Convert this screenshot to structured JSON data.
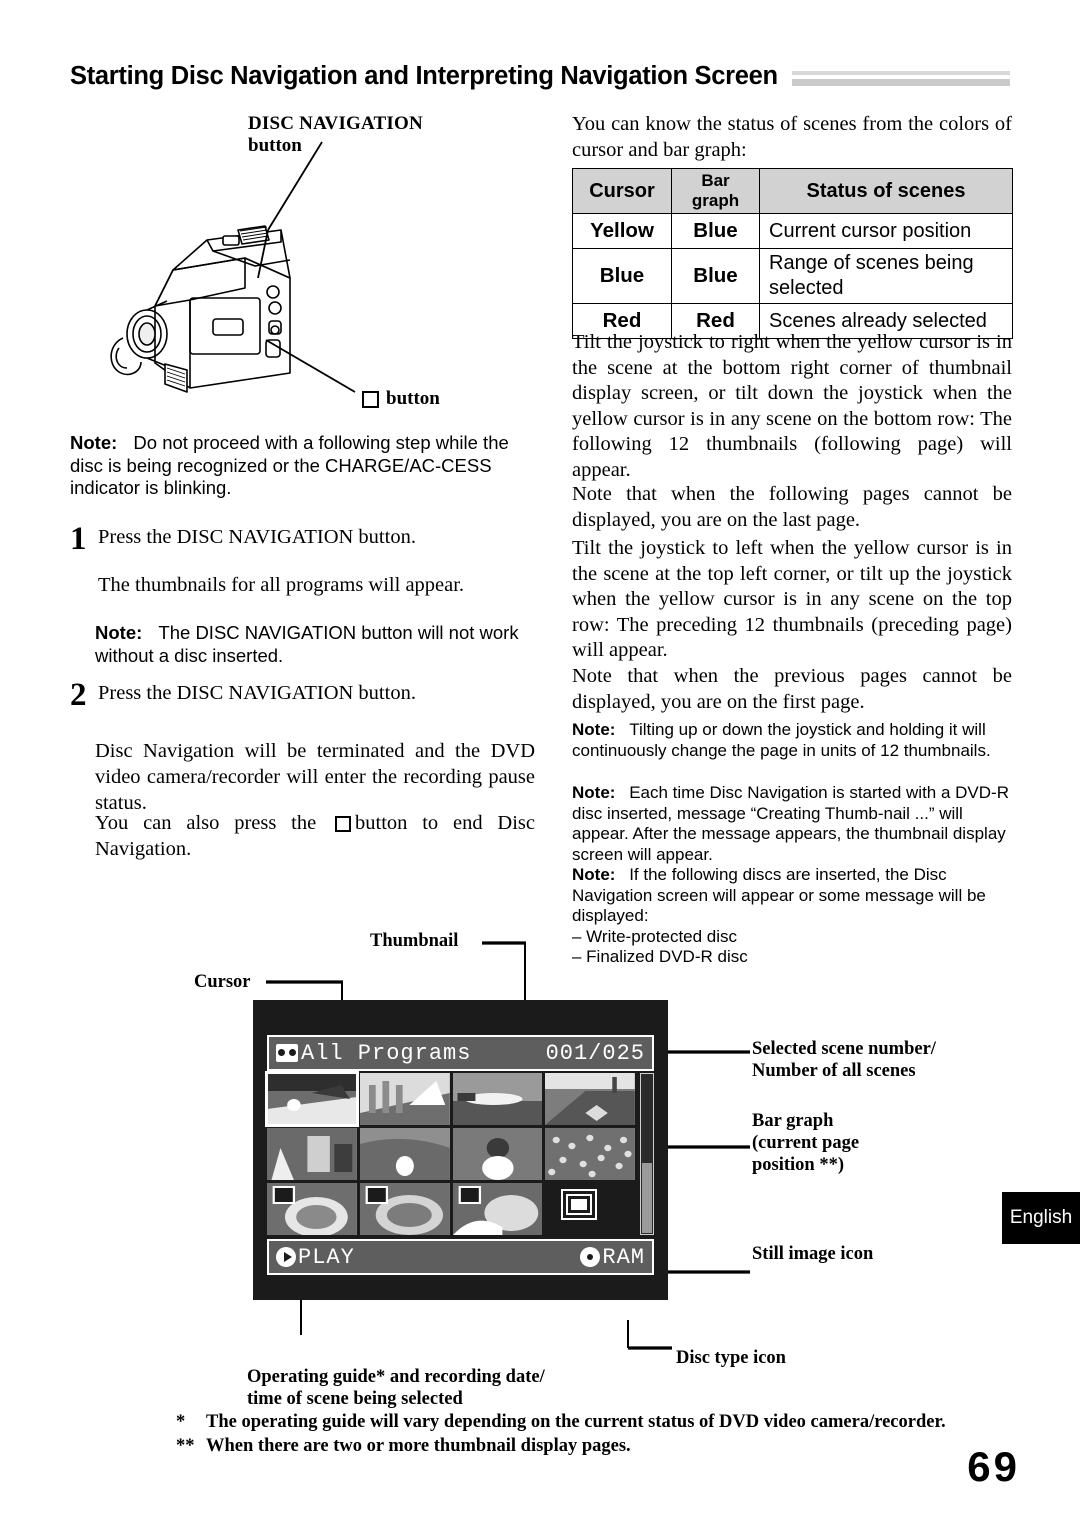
{
  "header": {
    "title": "Starting Disc Navigation and Interpreting Navigation Screen"
  },
  "illustration": {
    "disc_nav_label_line1": "DISC NAVIGATION",
    "disc_nav_label_line2": "button",
    "square_button_label": "button"
  },
  "left_column": {
    "note1": {
      "label": "Note:",
      "text": "Do not proceed with a following step while the disc is being recognized or the CHARGE/AC-CESS indicator is blinking."
    },
    "step1": {
      "number": "1",
      "instruction": "Press the DISC NAVIGATION button.",
      "result": "The thumbnails for all programs will appear."
    },
    "note2": {
      "label": "Note:",
      "text": "The DISC NAVIGATION button will not work without a disc inserted."
    },
    "step2": {
      "number": "2",
      "instruction": "Press the DISC NAVIGATION button.",
      "result_part1": "Disc Navigation will be terminated and the DVD video camera/recorder will enter the recording pause status.",
      "result_part2_pre": "You can also press the",
      "result_part2_post": "button to end Disc Navigation."
    }
  },
  "right_column": {
    "intro": "You can know the status of scenes from the colors of cursor and bar graph:",
    "table": {
      "headers": [
        "Cursor",
        "Bar graph",
        "Status of scenes"
      ],
      "rows": [
        {
          "cursor": "Yellow",
          "bar_graph": "Blue",
          "status": "Current cursor position"
        },
        {
          "cursor": "Blue",
          "bar_graph": "Blue",
          "status": "Range of scenes being selected"
        },
        {
          "cursor": "Red",
          "bar_graph": "Red",
          "status": "Scenes already selected"
        }
      ]
    },
    "para1": "Tilt the joystick to right when the yellow cursor is in the scene at the bottom right corner of thumbnail display screen, or tilt down the joystick when the yellow cursor is in any scene on the bottom row: The following 12 thumbnails (following page) will appear.",
    "para2": "Note that when the following pages cannot be displayed, you are on the last page.",
    "para3": "Tilt the joystick to left when the yellow cursor is in the scene at the top left corner, or tilt up the joystick when the yellow cursor is in any scene on the top row: The preceding 12 thumbnails (preceding page) will appear.",
    "para4": "Note that when the previous pages cannot be displayed, you are on the first page.",
    "note3": {
      "label": "Note:",
      "text": "Tilting up or down the joystick and holding it will continuously change the page in units of 12 thumbnails."
    },
    "note4": {
      "label": "Note:",
      "text": "Each time Disc Navigation is started with a DVD-R disc inserted, message “Creating Thumb-nail ...” will appear. After the message appears, the thumbnail display screen will appear."
    },
    "note5": {
      "label": "Note:",
      "text": "If the following discs are inserted, the Disc Navigation screen will appear or some message will be displayed:",
      "bullets": [
        "– Write-protected disc",
        "– Finalized DVD-R disc"
      ]
    }
  },
  "screen_diagram": {
    "callouts": {
      "thumbnail": "Thumbnail",
      "cursor": "Cursor",
      "selected_scene_number_line1": "Selected scene number/",
      "selected_scene_number_line2": "Number of all scenes",
      "bar_graph_line1": "Bar graph",
      "bar_graph_line2": "(current page",
      "bar_graph_line3": "position **)",
      "still_image_icon": "Still image icon",
      "disc_type_icon": "Disc type icon",
      "operating_guide_line1": "Operating guide* and recording date/",
      "operating_guide_line2": "time of scene being selected"
    },
    "lcd": {
      "program_title": "All Programs",
      "scene_counter": "001/025",
      "operating_guide": "PLAY",
      "disc_type": "RAM",
      "thumbnail_count": 11,
      "selected_index": 0
    }
  },
  "footnotes": [
    {
      "marker": "*",
      "text": "The operating guide will vary depending on the current status of DVD video camera/recorder."
    },
    {
      "marker": "**",
      "text": "When there are two or more thumbnail display pages."
    }
  ],
  "footer": {
    "language_tab": "English",
    "page_number": "69"
  }
}
